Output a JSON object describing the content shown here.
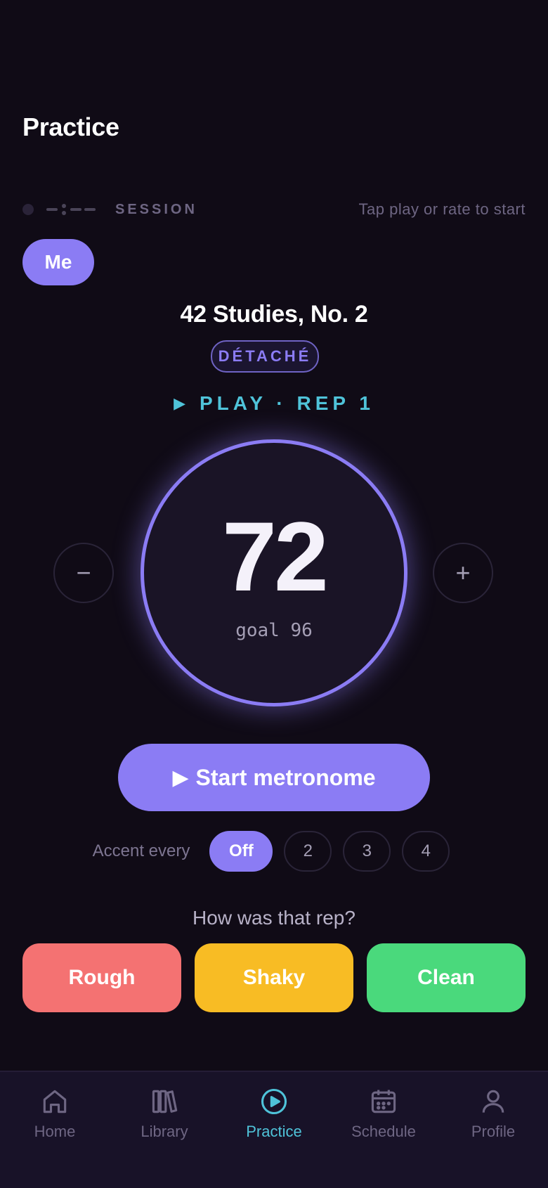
{
  "page": {
    "title": "Practice"
  },
  "session": {
    "label": "SESSION",
    "hint": "Tap play or rate to start"
  },
  "profile_chip": {
    "label": "Me"
  },
  "piece": {
    "title": "42 Studies, No. 2",
    "technique": "DÉTACHÉ"
  },
  "status": {
    "text": "PLAY · REP 1"
  },
  "tempo": {
    "value": "72",
    "goal_text": "goal 96",
    "decrement": "−",
    "increment": "+"
  },
  "metronome": {
    "start_label": "Start metronome"
  },
  "accent": {
    "label": "Accent every",
    "options": [
      "Off",
      "2",
      "3",
      "4"
    ],
    "selected": "Off"
  },
  "rating": {
    "prompt": "How was that rep?",
    "rough": "Rough",
    "shaky": "Shaky",
    "clean": "Clean"
  },
  "tabs": [
    {
      "label": "Home",
      "icon": "home-icon"
    },
    {
      "label": "Library",
      "icon": "library-icon"
    },
    {
      "label": "Practice",
      "icon": "play-circle-icon",
      "active": true
    },
    {
      "label": "Schedule",
      "icon": "calendar-icon"
    },
    {
      "label": "Profile",
      "icon": "person-icon"
    }
  ],
  "colors": {
    "accent": "#8b7cf4",
    "status": "#4fc3d9",
    "rough": "#f47272",
    "shaky": "#f8bc24",
    "clean": "#4ad97c",
    "background": "#100b16"
  }
}
